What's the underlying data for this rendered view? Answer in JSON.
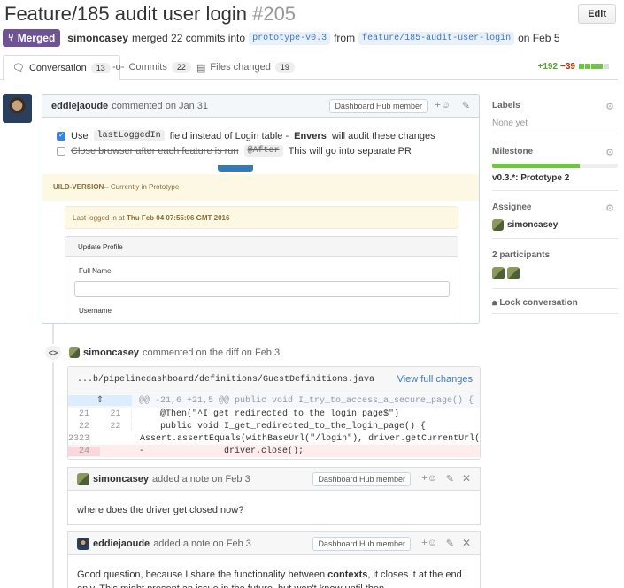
{
  "header": {
    "title": "Feature/185 audit user login",
    "number": "#205",
    "edit_label": "Edit"
  },
  "meta": {
    "state": "Merged",
    "author": "simoncasey",
    "text_merged": "merged 22 commits into",
    "base_branch": "prototype-v0.3",
    "text_from": "from",
    "head_branch": "feature/185-audit-user-login",
    "date": "on Feb 5"
  },
  "tabs": [
    {
      "label": "Conversation",
      "count": "13",
      "icon": "comment-icon"
    },
    {
      "label": "Commits",
      "count": "22",
      "icon": "commit-icon"
    },
    {
      "label": "Files changed",
      "count": "19",
      "icon": "file-diff-icon"
    }
  ],
  "diffstat": {
    "additions": "+192",
    "deletions": "−39"
  },
  "main_comment": {
    "author": "eddiejaoude",
    "action": "commented on Jan 31",
    "member_tag": "Dashboard Hub member",
    "task1_pre": "Use",
    "task1_code": "lastLoggedIn",
    "task1_mid": "field instead of Login table -",
    "task1_bold": "Envers",
    "task1_post": "will audit these changes",
    "task2_strike": "Close browser after each feature is run",
    "task2_code": "@After",
    "task2_post": "This will go into separate PR",
    "screenshot": {
      "banner_bold": "UILD-VERSION--",
      "banner_text": "Currently in Prototype",
      "login_prefix": "Last logged in at",
      "login_time": "Thu Feb 04 07:55:06 GMT 2016",
      "panel_title": "Update Profile",
      "field_label": "Full Name",
      "field2_label": "Username"
    }
  },
  "diff_event": {
    "author": "simoncasey",
    "action": "commented on the diff on Feb 3"
  },
  "file": {
    "path": "...b/pipelinedashboard/definitions/GuestDefinitions.java",
    "view_full": "View full changes",
    "hunk": "@@ -21,6 +21,5 @@ public void I_try_to_access_a_secure_page() {",
    "lines": [
      {
        "old": "21",
        "new": "21",
        "sign": " ",
        "text": "    @Then(\"^I get redirected to the login page$\")",
        "type": "ctx"
      },
      {
        "old": "22",
        "new": "22",
        "sign": " ",
        "text": "    public void I_get_redirected_to_the_login_page() {",
        "type": "ctx"
      },
      {
        "old": "23",
        "new": "23",
        "sign": " ",
        "text": "        Assert.assertEquals(withBaseUrl(\"/login\"), driver.getCurrentUrl())",
        "type": "ctx"
      },
      {
        "old": "24",
        "new": "",
        "sign": "-",
        "text": "        driver.close();",
        "type": "del"
      }
    ]
  },
  "notes": [
    {
      "author": "simoncasey",
      "action": "added a note on Feb 3",
      "member_tag": "Dashboard Hub member",
      "body": "where does the driver get closed now?"
    },
    {
      "author": "eddiejaoude",
      "action": "added a note on Feb 3",
      "member_tag": "Dashboard Hub member",
      "body_pre": "Good question, because I share the functionality between",
      "body_bold": "contexts",
      "body_post": ", it closes it at the end only. This might present an issue in the future, but won't know until then."
    }
  ],
  "sidebar": {
    "labels_title": "Labels",
    "labels_value": "None yet",
    "milestone_title": "Milestone",
    "milestone_progress": 0.7,
    "milestone_name": "v0.3.*: Prototype 2",
    "assignee_title": "Assignee",
    "assignee_name": "simoncasey",
    "participants_title": "2 participants",
    "lock_label": "Lock conversation"
  },
  "colors": {
    "merged": "#6e5494",
    "link": "#4078c0",
    "additions": "#55a532",
    "deletions": "#bd2c00"
  }
}
